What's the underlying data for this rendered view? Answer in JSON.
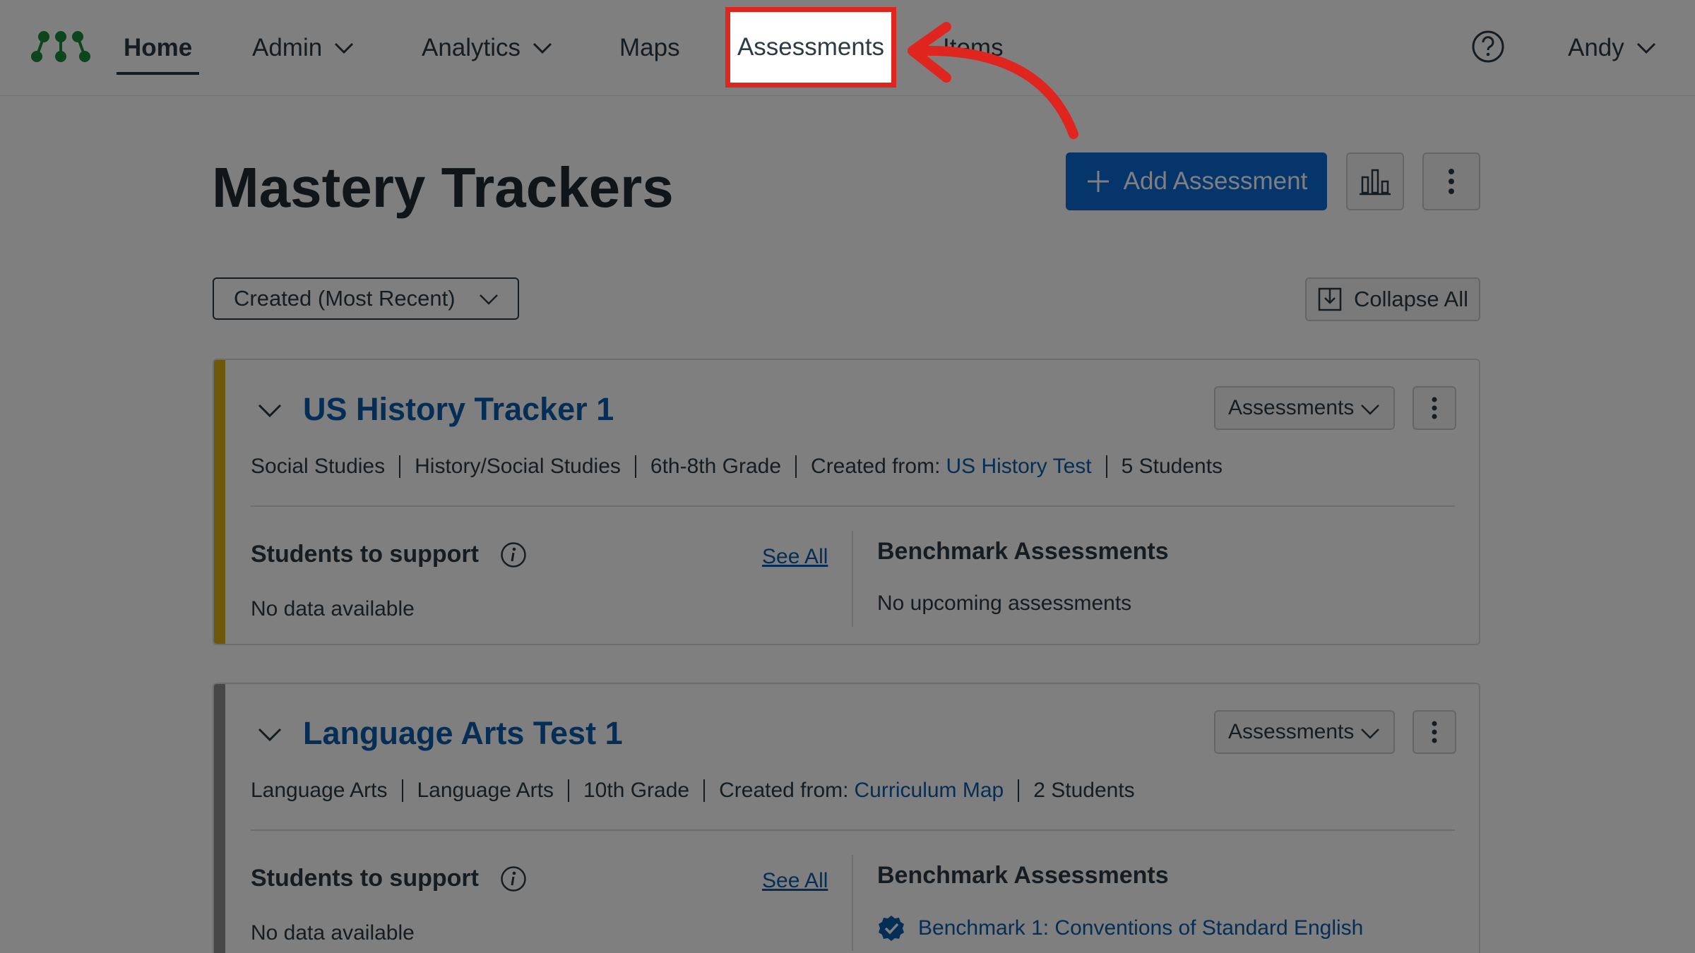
{
  "nav": {
    "home": "Home",
    "admin": "Admin",
    "analytics": "Analytics",
    "maps": "Maps",
    "assessments": "Assessments",
    "items": "Items",
    "user": "Andy"
  },
  "page": {
    "title": "Mastery Trackers",
    "add_button": "Add Assessment",
    "sort_value": "Created (Most Recent)",
    "collapse_all": "Collapse All"
  },
  "colors": {
    "overlay": "#000000",
    "highlight": "#e0241e",
    "primary": "#0a6ad6",
    "link": "#0b5cad",
    "stripe_1": "#d8af14",
    "stripe_2": "#8f8f8f",
    "logo": "#1a8a3a"
  },
  "trackers": [
    {
      "title": "US History Tracker 1",
      "dropdown": "Assessments",
      "meta": [
        "Social Studies",
        "History/Social Studies",
        "6th-8th Grade"
      ],
      "created_from_label": "Created from:",
      "created_from_link": "US History Test",
      "students": "5 Students",
      "support_title": "Students to support",
      "see_all": "See All",
      "support_empty": "No data available",
      "bench_title": "Benchmark Assessments",
      "bench_empty": "No upcoming assessments"
    },
    {
      "title": "Language Arts Test 1",
      "dropdown": "Assessments",
      "meta": [
        "Language Arts",
        "Language Arts",
        "10th Grade"
      ],
      "created_from_label": "Created from:",
      "created_from_link": "Curriculum Map",
      "students": "2 Students",
      "support_title": "Students to support",
      "see_all": "See All",
      "support_empty": "No data available",
      "bench_title": "Benchmark Assessments",
      "bench_item": "Benchmark 1: Conventions of Standard English"
    }
  ]
}
